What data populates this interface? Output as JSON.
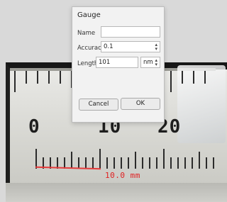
{
  "dialog": {
    "title": "Gauge",
    "name_label": "Name",
    "name_value": "",
    "accuracy_label": "Accuracy",
    "accuracy_value": "0.1",
    "length_label": "Length",
    "length_value": "101",
    "unit_value": "nm",
    "cancel_label": "Cancel",
    "ok_label": "OK"
  },
  "photo": {
    "ruler_numbers": [
      "0",
      "10",
      "20"
    ],
    "measurement_label": "10.0 mm",
    "measurement_color": "#e02020"
  },
  "icons": {
    "select_arrow": "up-down-chevron-icon"
  }
}
